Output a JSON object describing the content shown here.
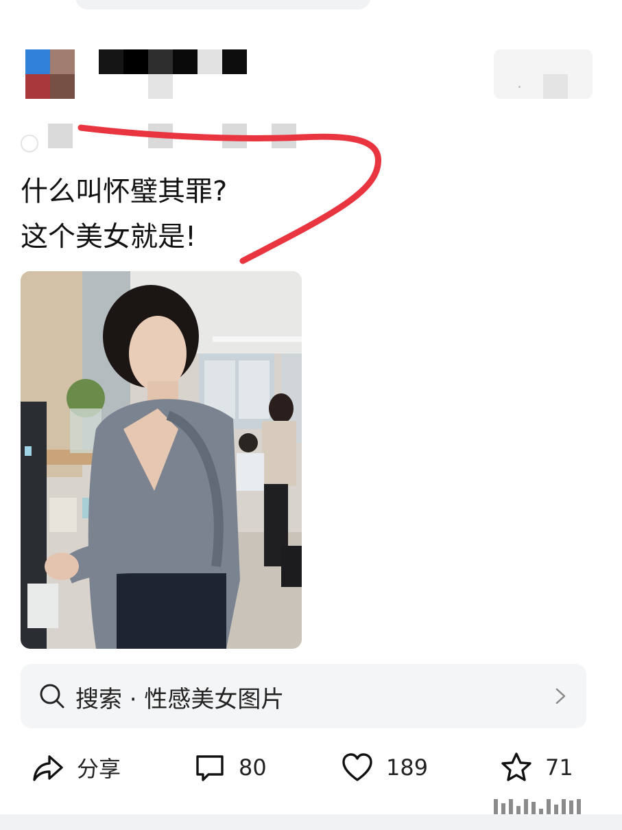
{
  "post": {
    "text_lines": [
      "什么叫怀璧其罪?",
      "这个美女就是!"
    ]
  },
  "image": {
    "alt": "办公室里接水的女子"
  },
  "search": {
    "label": "搜索 · 性感美女图片"
  },
  "actions": {
    "share_label": "分享",
    "comment_count": "80",
    "like_count": "189",
    "favorite_count": "71"
  },
  "icons": {
    "search": "search-icon",
    "chevron": "chevron-right-icon",
    "share": "share-icon",
    "comment": "comment-icon",
    "like": "heart-icon",
    "favorite": "star-icon"
  },
  "colors": {
    "annotation_red": "#e8353f",
    "search_bg": "#f4f5f7",
    "text": "#111111"
  }
}
